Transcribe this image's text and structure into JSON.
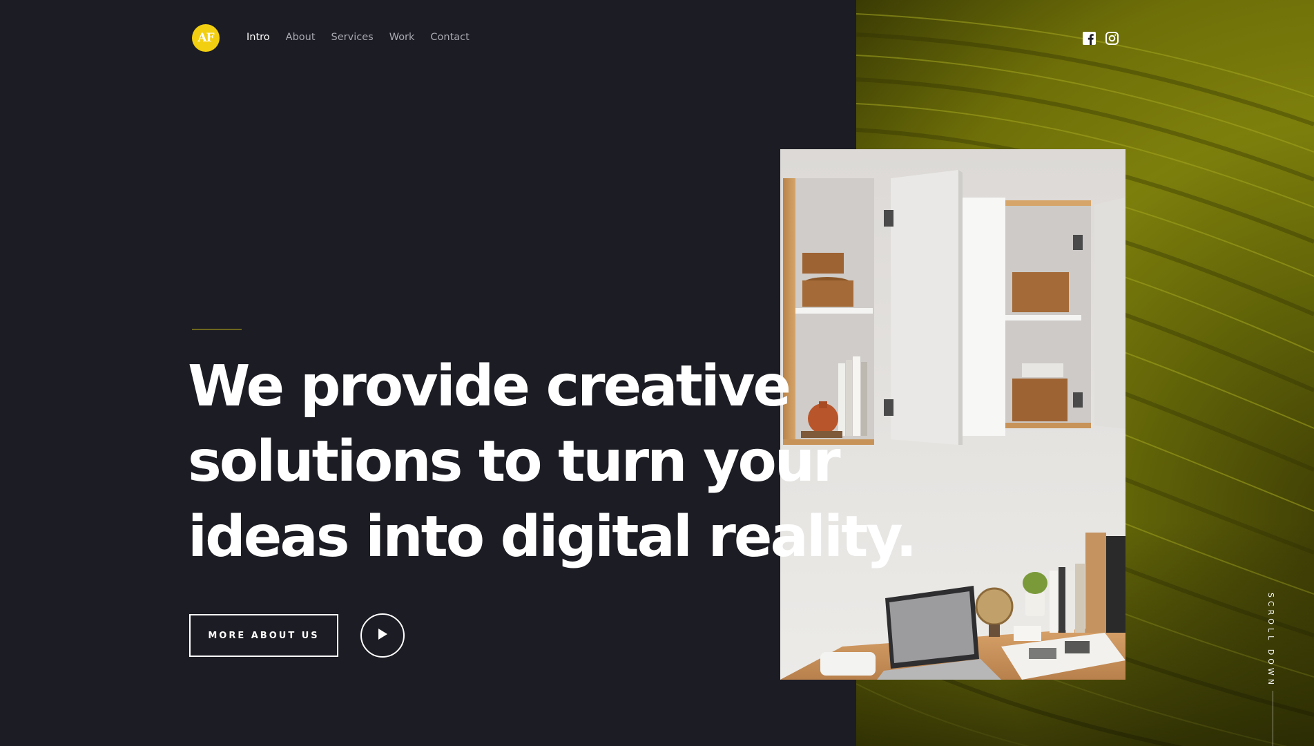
{
  "header": {
    "logo_text": "AF",
    "nav": [
      {
        "label": "Intro",
        "active": true
      },
      {
        "label": "About",
        "active": false
      },
      {
        "label": "Services",
        "active": false
      },
      {
        "label": "Work",
        "active": false
      },
      {
        "label": "Contact",
        "active": false
      }
    ],
    "social": [
      "facebook-icon",
      "instagram-icon"
    ]
  },
  "hero": {
    "headline_lines": [
      "We provide creative",
      "solutions to turn your",
      "ideas into digital reality."
    ],
    "more_button_label": "MORE ABOUT US",
    "play_button_icon": "play-icon"
  },
  "scroll": {
    "label": "SCROLL DOWN"
  },
  "colors": {
    "background": "#1c1c24",
    "accent": "#f2cf10",
    "backdrop_green": "#7d7f0c",
    "text": "#ffffff",
    "nav_inactive": "#a9a9b2"
  }
}
